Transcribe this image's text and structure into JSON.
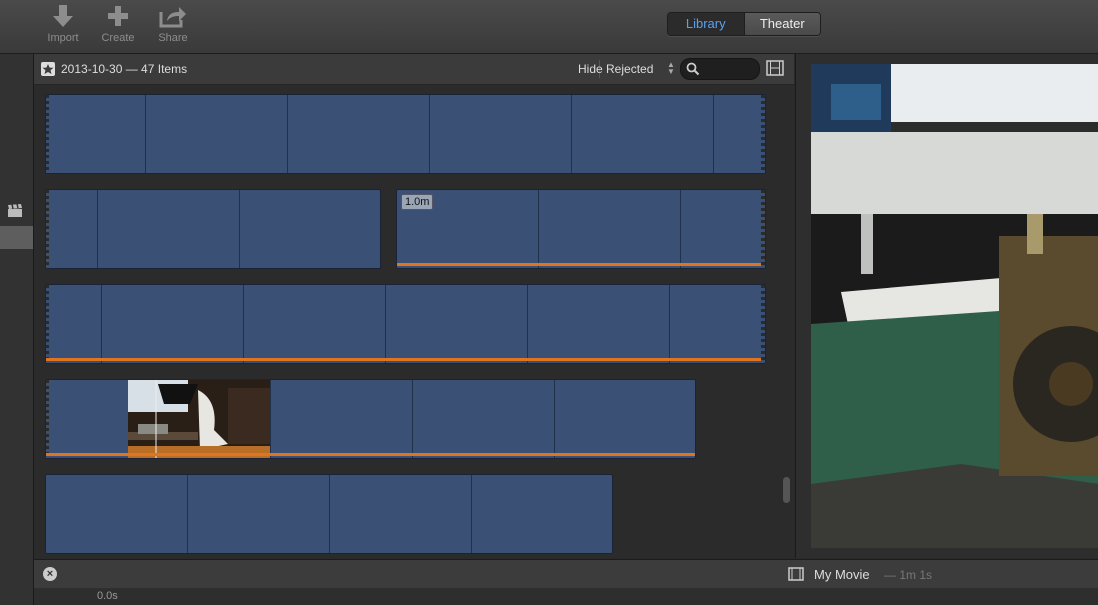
{
  "toolbar": {
    "import_label": "Import",
    "create_label": "Create",
    "share_label": "Share",
    "segment": {
      "library_label": "Library",
      "theater_label": "Theater",
      "selected": "Library"
    }
  },
  "browser": {
    "event_title": "2013-10-30 — 47 Items",
    "filter_label": "Hide Rejected",
    "search": {
      "placeholder": ""
    },
    "clip_badge": "1.0m"
  },
  "bottom": {
    "project_name": "My Movie",
    "project_duration": "— 1m 1s",
    "timeline_start": "0.0s"
  },
  "colors": {
    "accent": "#5aa0f0",
    "clip_fill": "#3a5175",
    "favorite_bar": "#e0741f"
  }
}
